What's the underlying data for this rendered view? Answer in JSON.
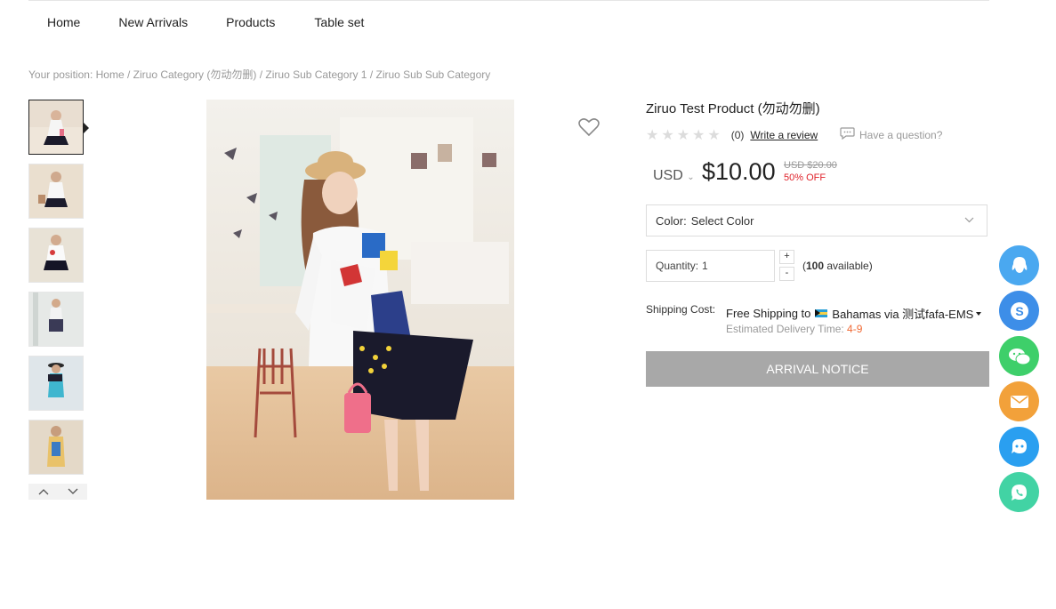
{
  "nav": {
    "items": [
      "Home",
      "New Arrivals",
      "Products",
      "Table set"
    ]
  },
  "breadcrumb": {
    "prefix": "Your position:",
    "items": [
      "Home",
      "Ziruo Category (勿动勿删)",
      "Ziruo Sub Category 1",
      "Ziruo Sub Sub Category"
    ],
    "separator": "/"
  },
  "gallery": {
    "thumbnails": [
      "thumb-1",
      "thumb-2",
      "thumb-3",
      "thumb-4",
      "thumb-5",
      "thumb-6"
    ],
    "prev_icon": "chevron-up-icon",
    "next_icon": "chevron-down-icon"
  },
  "product": {
    "title": "Ziruo Test Product (勿动勿删)",
    "review_count": "(0)",
    "write_review": "Write a review",
    "question": "Have a question?",
    "currency": "USD",
    "price": "$10.00",
    "old_price": "USD $20.00",
    "discount": "50% OFF",
    "color_label": "Color:",
    "color_value": "Select Color",
    "quantity_label": "Quantity:",
    "quantity_value": "1",
    "plus": "+",
    "minus": "-",
    "available_prefix": "(",
    "available_count": "100",
    "available_suffix": " available)",
    "shipping_label": "Shipping Cost:",
    "shipping_free": "Free Shipping to",
    "shipping_country": "Bahamas via 测试fafa-EMS",
    "estimated_label": "Estimated Delivery Time:",
    "estimated_days": "4-9",
    "arrival_button": "ARRIVAL NOTICE"
  },
  "side_icons": [
    {
      "name": "qq-icon",
      "color": "#4aa8f0"
    },
    {
      "name": "skype-icon",
      "color": "#3d8ee8"
    },
    {
      "name": "wechat-icon",
      "color": "#3ecf6a"
    },
    {
      "name": "email-icon",
      "color": "#f2a13a"
    },
    {
      "name": "messenger-icon",
      "color": "#2a9ff0"
    },
    {
      "name": "whatsapp-icon",
      "color": "#42d3a4"
    }
  ],
  "colors": {
    "accent_red": "#e0232b",
    "button_gray": "#a8a8a8",
    "days_orange": "#f06a35"
  }
}
